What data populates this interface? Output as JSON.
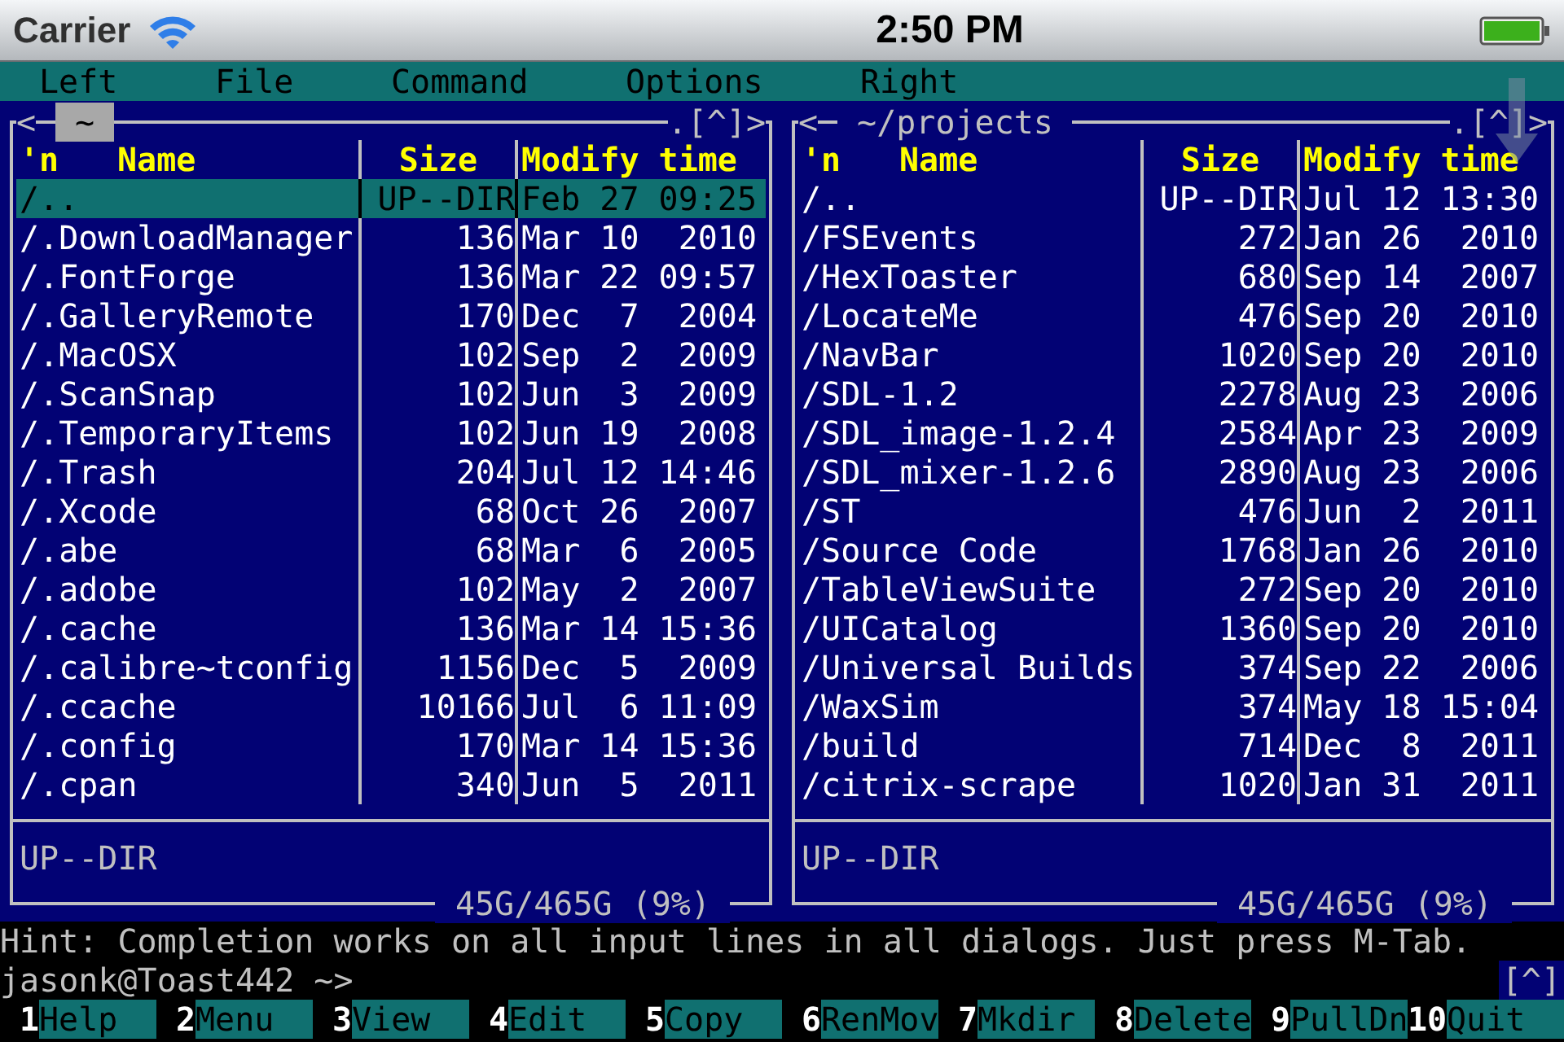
{
  "status_bar": {
    "carrier": "Carrier",
    "time": "2:50 PM"
  },
  "menu": [
    {
      "label": "Left"
    },
    {
      "label": "File"
    },
    {
      "label": "Command"
    },
    {
      "label": "Options"
    },
    {
      "label": "Right"
    }
  ],
  "panels": [
    {
      "title": "~",
      "selected": true,
      "nav_left": "<",
      "nav_right": ".[^]>",
      "columns": [
        "'n",
        "Name",
        "Size",
        "Modify time"
      ],
      "rows": [
        {
          "name": "/..",
          "size": "UP--DIR",
          "time": "Feb 27 09:25",
          "selected": true
        },
        {
          "name": "/.DownloadManager",
          "size": "136",
          "time": "Mar 10  2010",
          "selected": false
        },
        {
          "name": "/.FontForge",
          "size": "136",
          "time": "Mar 22 09:57",
          "selected": false
        },
        {
          "name": "/.GalleryRemote",
          "size": "170",
          "time": "Dec  7  2004",
          "selected": false
        },
        {
          "name": "/.MacOSX",
          "size": "102",
          "time": "Sep  2  2009",
          "selected": false
        },
        {
          "name": "/.ScanSnap",
          "size": "102",
          "time": "Jun  3  2009",
          "selected": false
        },
        {
          "name": "/.TemporaryItems",
          "size": "102",
          "time": "Jun 19  2008",
          "selected": false
        },
        {
          "name": "/.Trash",
          "size": "204",
          "time": "Jul 12 14:46",
          "selected": false
        },
        {
          "name": "/.Xcode",
          "size": "68",
          "time": "Oct 26  2007",
          "selected": false
        },
        {
          "name": "/.abe",
          "size": "68",
          "time": "Mar  6  2005",
          "selected": false
        },
        {
          "name": "/.adobe",
          "size": "102",
          "time": "May  2  2007",
          "selected": false
        },
        {
          "name": "/.cache",
          "size": "136",
          "time": "Mar 14 15:36",
          "selected": false
        },
        {
          "name": "/.calibre~tconfig",
          "size": "1156",
          "time": "Dec  5  2009",
          "selected": false
        },
        {
          "name": "/.ccache",
          "size": "10166",
          "time": "Jul  6 11:09",
          "selected": false
        },
        {
          "name": "/.config",
          "size": "170",
          "time": "Mar 14 15:36",
          "selected": false
        },
        {
          "name": "/.cpan",
          "size": "340",
          "time": "Jun  5  2011",
          "selected": false
        }
      ],
      "mini_status": "UP--DIR",
      "disk": "45G/465G (9%)"
    },
    {
      "title": "~/projects",
      "selected": false,
      "nav_left": "<",
      "nav_right": ".[^]>",
      "columns": [
        "'n",
        "Name",
        "Size",
        "Modify time"
      ],
      "rows": [
        {
          "name": "/..",
          "size": "UP--DIR",
          "time": "Jul 12 13:30",
          "selected": false
        },
        {
          "name": "/FSEvents",
          "size": "272",
          "time": "Jan 26  2010",
          "selected": false
        },
        {
          "name": "/HexToaster",
          "size": "680",
          "time": "Sep 14  2007",
          "selected": false
        },
        {
          "name": "/LocateMe",
          "size": "476",
          "time": "Sep 20  2010",
          "selected": false
        },
        {
          "name": "/NavBar",
          "size": "1020",
          "time": "Sep 20  2010",
          "selected": false
        },
        {
          "name": "/SDL-1.2",
          "size": "2278",
          "time": "Aug 23  2006",
          "selected": false
        },
        {
          "name": "/SDL_image-1.2.4",
          "size": "2584",
          "time": "Apr 23  2009",
          "selected": false
        },
        {
          "name": "/SDL_mixer-1.2.6",
          "size": "2890",
          "time": "Aug 23  2006",
          "selected": false
        },
        {
          "name": "/ST",
          "size": "476",
          "time": "Jun  2  2011",
          "selected": false
        },
        {
          "name": "/Source Code",
          "size": "1768",
          "time": "Jan 26  2010",
          "selected": false
        },
        {
          "name": "/TableViewSuite",
          "size": "272",
          "time": "Sep 20  2010",
          "selected": false
        },
        {
          "name": "/UICatalog",
          "size": "1360",
          "time": "Sep 20  2010",
          "selected": false
        },
        {
          "name": "/Universal Builds",
          "size": "374",
          "time": "Sep 22  2006",
          "selected": false
        },
        {
          "name": "/WaxSim",
          "size": "374",
          "time": "May 18 15:04",
          "selected": false
        },
        {
          "name": "/build",
          "size": "714",
          "time": "Dec  8  2011",
          "selected": false
        },
        {
          "name": "/citrix-scrape",
          "size": "1020",
          "time": "Jan 31  2011",
          "selected": false
        }
      ],
      "mini_status": "UP--DIR",
      "disk": "45G/465G (9%)"
    }
  ],
  "hint": "Hint: Completion works on all input lines in all dialogs. Just press M-Tab.",
  "prompt": "jasonk@Toast442 ~>",
  "history_button": "[^]",
  "function_keys": [
    {
      "number": "1",
      "label": "Help"
    },
    {
      "number": "2",
      "label": "Menu"
    },
    {
      "number": "3",
      "label": "View"
    },
    {
      "number": "4",
      "label": "Edit"
    },
    {
      "number": "5",
      "label": "Copy"
    },
    {
      "number": "6",
      "label": "RenMov"
    },
    {
      "number": "7",
      "label": "Mkdir"
    },
    {
      "number": "8",
      "label": "Delete"
    },
    {
      "number": "9",
      "label": "PullDn"
    },
    {
      "number": "10",
      "label": "Quit"
    }
  ]
}
